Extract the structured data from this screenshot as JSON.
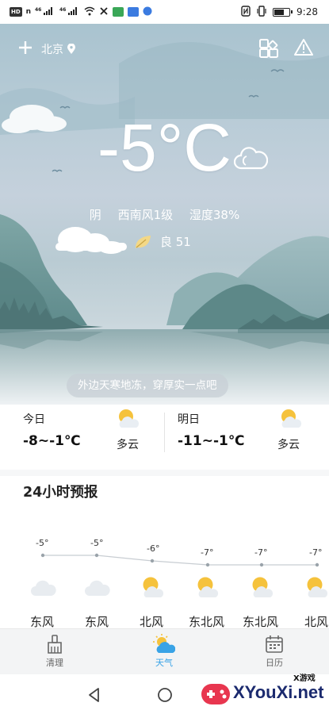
{
  "status_bar": {
    "left_chips": [
      "HD",
      "n",
      "46",
      "46"
    ],
    "time": "9:28"
  },
  "header": {
    "add_label": "+",
    "city": "北京"
  },
  "current": {
    "temperature": "-5°C",
    "condition": "阴",
    "wind": "西南风1级",
    "humidity": "湿度38%",
    "aqi": "良 51"
  },
  "tip": "外边天寒地冻，穿厚实一点吧",
  "today": {
    "label": "今日",
    "range": "-8~-1℃",
    "condition": "多云",
    "icon": "partly-cloudy-icon"
  },
  "tomorrow": {
    "label": "明日",
    "range": "-11~-1℃",
    "condition": "多云",
    "icon": "partly-cloudy-icon"
  },
  "hourly_section": {
    "title": "24小时预报",
    "hours": [
      {
        "temp": "-5°",
        "icon": "cloudy-icon",
        "wind": "东风"
      },
      {
        "temp": "-5°",
        "icon": "cloudy-icon",
        "wind": "东风"
      },
      {
        "temp": "-6°",
        "icon": "partly-cloudy-icon",
        "wind": "北风"
      },
      {
        "temp": "-7°",
        "icon": "partly-cloudy-icon",
        "wind": "东北风"
      },
      {
        "temp": "-7°",
        "icon": "partly-cloudy-icon",
        "wind": "东北风"
      },
      {
        "temp": "-7°",
        "icon": "partly-cloudy-icon",
        "wind": "北风"
      }
    ]
  },
  "bottom_nav": {
    "items": [
      {
        "label": "清理",
        "icon": "broom-icon",
        "active": false
      },
      {
        "label": "天气",
        "icon": "weather-icon",
        "active": true
      },
      {
        "label": "日历",
        "icon": "calendar-icon",
        "active": false
      }
    ]
  },
  "watermark": {
    "small": "X游戏",
    "big": "XYouXi.net"
  },
  "colors": {
    "accent": "#39a3e6",
    "sun": "#f5c23c",
    "hero_top": "#a9c3cf",
    "mountain": "#6f9a98"
  }
}
